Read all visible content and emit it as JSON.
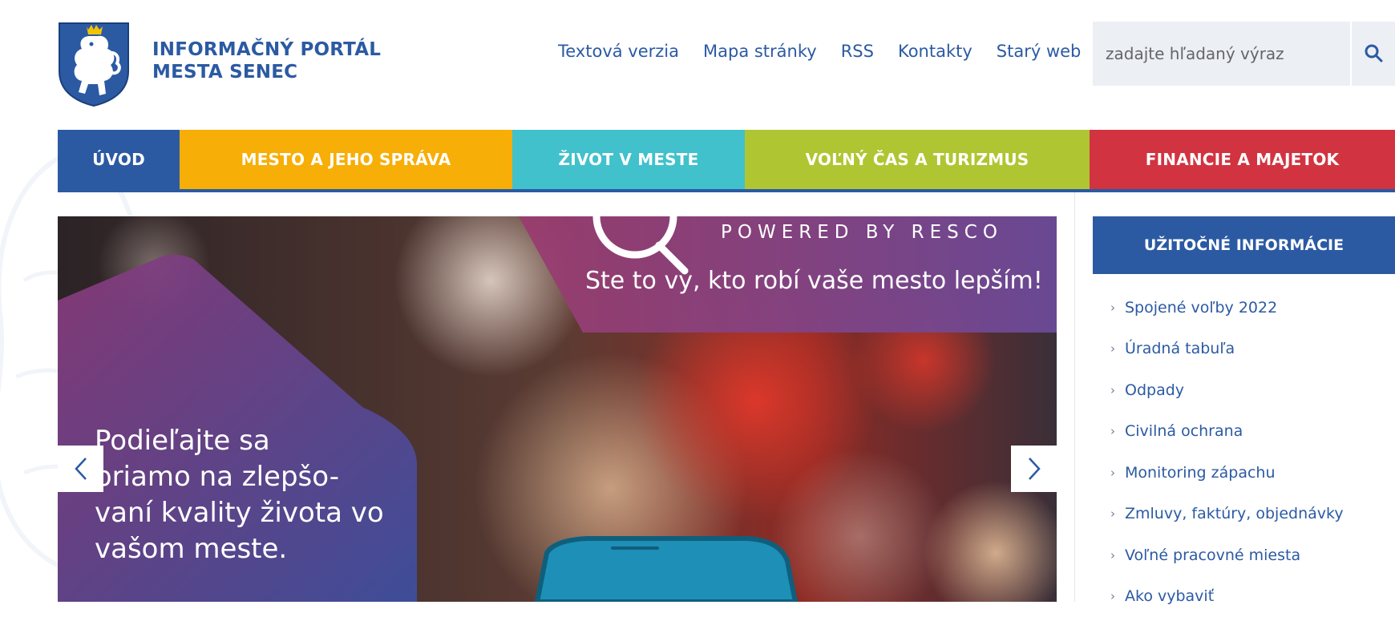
{
  "header": {
    "title_line1": "INFORMAČNÝ PORTÁL",
    "title_line2": "MESTA SENEC",
    "top_links": [
      "Textová verzia",
      "Mapa stránky",
      "RSS",
      "Kontakty",
      "Starý web"
    ],
    "search_placeholder": "zadajte hľadaný výraz",
    "search_icon": "search-icon"
  },
  "nav": {
    "items": [
      {
        "label": "ÚVOD",
        "color": "#2b5aa3"
      },
      {
        "label": "MESTO A JEHO SPRÁVA",
        "color": "#f7ae06"
      },
      {
        "label": "ŽIVOT V MESTE",
        "color": "#41c1cb"
      },
      {
        "label": "VOĽNÝ ČAS A TURIZMUS",
        "color": "#afc632"
      },
      {
        "label": "FINANCIE A MAJETOK",
        "color": "#d13440"
      }
    ]
  },
  "slider": {
    "powered": "POWERED BY RESCO",
    "tagline": "Ste to vy, kto robí vaše mesto lepším!",
    "text_lines": [
      "Podieľajte sa",
      "priamo na zlepšo-",
      "vaní kvality života vo",
      "vašom meste."
    ]
  },
  "sidebar": {
    "header": "UŽITOČNÉ INFORMÁCIE",
    "items": [
      "Spojené voľby 2022",
      "Úradná tabuľa",
      "Odpady",
      "Civilná ochrana",
      "Monitoring zápachu",
      "Zmluvy, faktúry, objednávky",
      "Voľné pracovné miesta",
      "Ako vybaviť"
    ]
  },
  "colors": {
    "brand_blue": "#2b5aa3",
    "search_bg": "#eceff4"
  }
}
